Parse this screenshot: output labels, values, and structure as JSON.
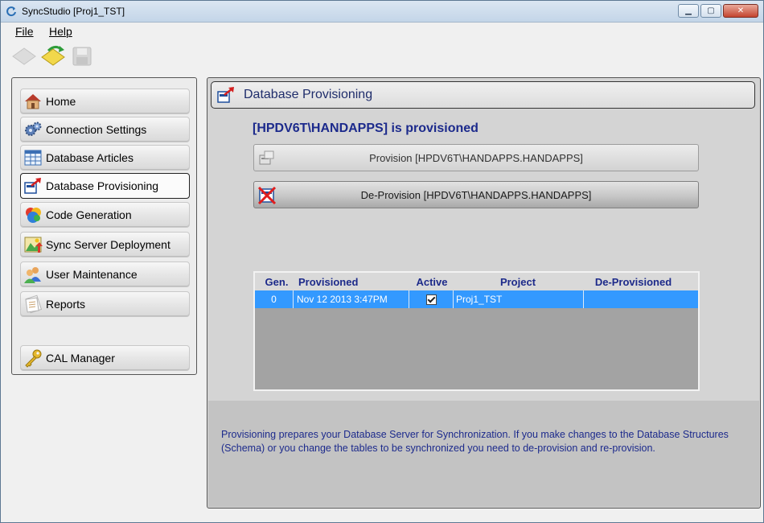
{
  "window": {
    "title": "SyncStudio [Proj1_TST]",
    "controls": {
      "minimize": "minimize-icon",
      "maximize": "maximize-icon",
      "close": "close-icon"
    }
  },
  "menu": {
    "items": [
      "File",
      "Help"
    ]
  },
  "toolbar": {
    "buttons": [
      "new-icon",
      "open-icon",
      "save-icon"
    ]
  },
  "nav": {
    "items": [
      {
        "label": "Home",
        "icon": "home-icon",
        "active": false
      },
      {
        "label": "Connection Settings",
        "icon": "gears-icon",
        "active": false
      },
      {
        "label": "Database Articles",
        "icon": "table-icon",
        "active": false
      },
      {
        "label": "Database Provisioning",
        "icon": "provision-icon",
        "active": true
      },
      {
        "label": "Code Generation",
        "icon": "colored-spheres-icon",
        "active": false
      },
      {
        "label": "Sync Server Deployment",
        "icon": "deploy-icon",
        "active": false
      },
      {
        "label": "User Maintenance",
        "icon": "users-icon",
        "active": false
      },
      {
        "label": "Reports",
        "icon": "reports-icon",
        "active": false
      }
    ],
    "cal_manager": {
      "label": "CAL Manager",
      "icon": "key-icon"
    }
  },
  "content": {
    "header_title": "Database Provisioning",
    "status": "[HPDV6T\\HANDAPPS] is provisioned",
    "provision_button": "Provision  [HPDV6T\\HANDAPPS.HANDAPPS]",
    "deprovision_button": "De-Provision  [HPDV6T\\HANDAPPS.HANDAPPS]",
    "grid": {
      "columns": [
        "Gen.",
        "Provisioned",
        "Active",
        "Project",
        "De-Provisioned"
      ],
      "rows": [
        {
          "gen": "0",
          "provisioned": "Nov 12 2013  3:47PM",
          "active": true,
          "project": "Proj1_TST",
          "deprovisioned": ""
        }
      ]
    },
    "footer_text": "Provisioning prepares your Database Server for Synchronization. If you make changes to the Database Structures (Schema) or you change the tables to be synchronized you need to de-provision and re-provision."
  },
  "colors": {
    "accent_text": "#1c2a8c",
    "selection": "#3399ff",
    "grid_background": "#a3a3a3"
  }
}
